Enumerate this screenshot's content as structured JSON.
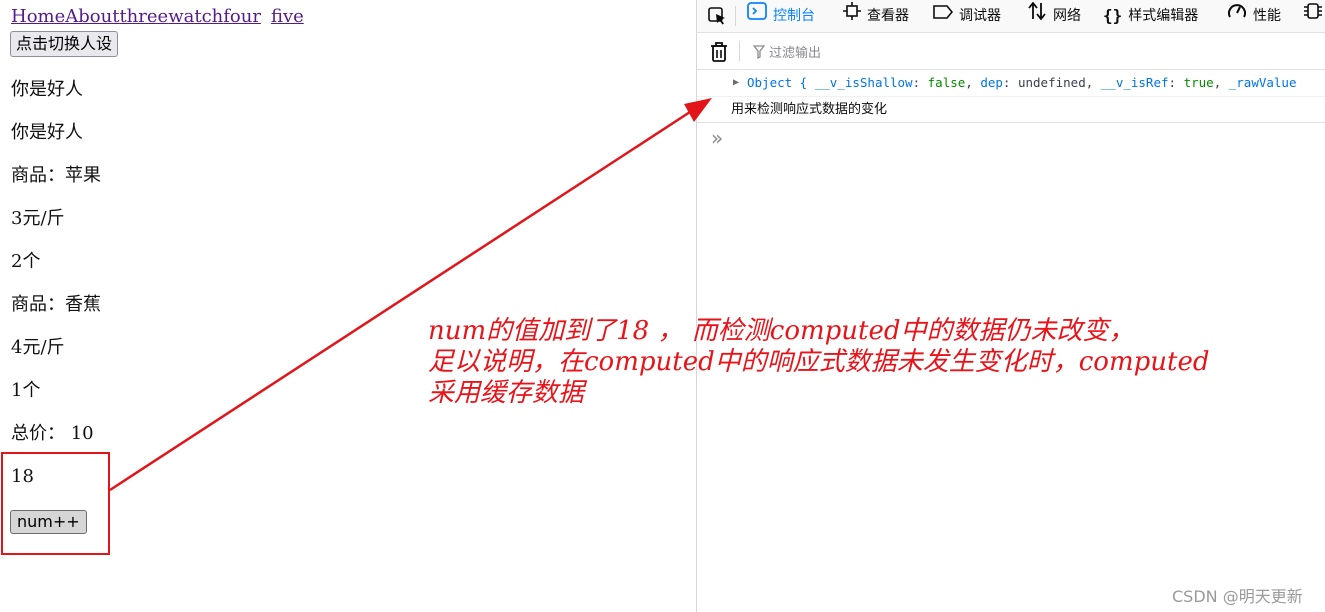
{
  "page": {
    "nav_links": [
      "Home",
      "About",
      "three",
      "watch",
      "four",
      "five"
    ],
    "switch_button": "点击切换人设",
    "lines": [
      "你是好人",
      "你是好人",
      "商品：苹果",
      "3元/斤",
      "2个",
      "商品：香蕉",
      "4元/斤",
      "1个",
      "总价： 10",
      "18"
    ],
    "num_button": "num++"
  },
  "devtools": {
    "tabs": [
      {
        "label": "控制台",
        "icon": "console-icon",
        "active": true
      },
      {
        "label": "查看器",
        "icon": "inspector-icon",
        "active": false
      },
      {
        "label": "调试器",
        "icon": "debugger-icon",
        "active": false
      },
      {
        "label": "网络",
        "icon": "network-icon",
        "active": false
      },
      {
        "label": "样式编辑器",
        "icon": "style-editor-icon",
        "active": false
      },
      {
        "label": "性能",
        "icon": "performance-icon",
        "active": false
      }
    ],
    "filter_placeholder": "过滤输出",
    "log_object": {
      "prefix": "Object { ",
      "k1": "__v_isShallow",
      "v1": "false",
      "k2": "dep",
      "v2": "undefined",
      "k3": "__v_isRef",
      "v3": "true",
      "k4": "_rawValue"
    },
    "log_text": "用来检测响应式数据的变化",
    "prompt_symbol": "»"
  },
  "annotation": {
    "lines": [
      "num的值加到了18 ， 而检测computed中的数据仍未改变，",
      "足以说明，在computed中的响应式数据未发生变化时，computed",
      "采用缓存数据"
    ],
    "color": "#e8141a"
  },
  "watermark": "CSDN @明天更新"
}
